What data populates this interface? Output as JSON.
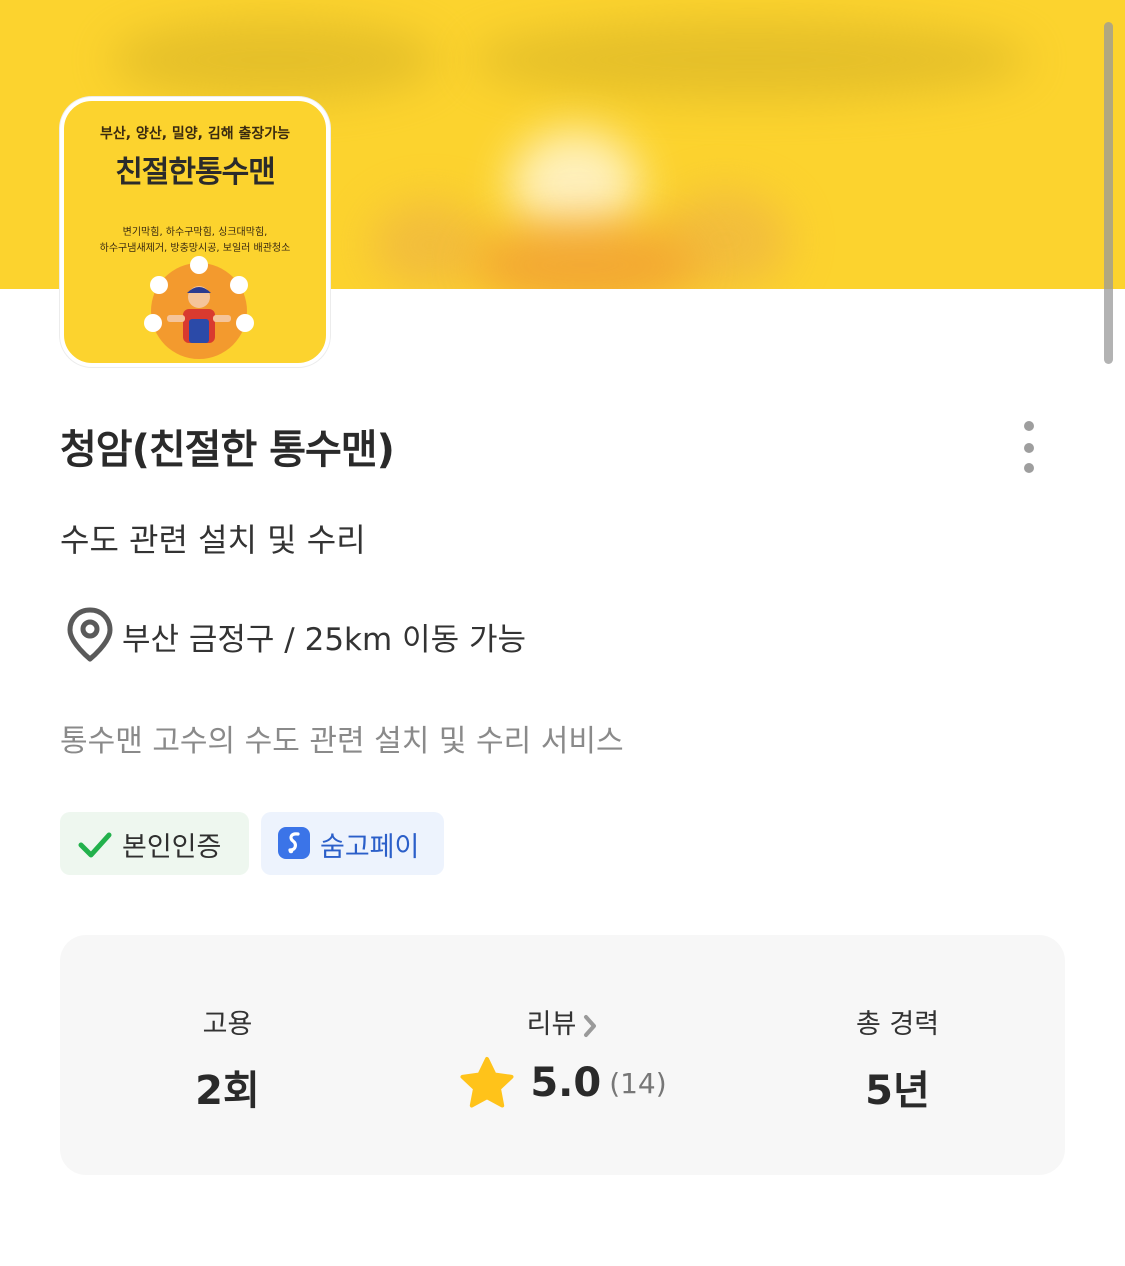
{
  "banner": {
    "background_color": "#fcd32e"
  },
  "profile_image": {
    "service_area": "부산, 양산, 밀양, 김해 출장가능",
    "brand": "친절한통수맨",
    "services_line1": "변기막힘, 하수구막힘, 싱크대막힘,",
    "services_line2": "하수구냄새제거, 방충망시공, 보일러 배관청소"
  },
  "profile": {
    "name": "청암(친절한 통수맨)",
    "category": "수도 관련 설치 및 수리",
    "location": "부산 금정구 / 25km 이동 가능",
    "intro": "통수맨 고수의 수도 관련 설치 및 수리 서비스",
    "more_icon": "more-vertical-icon",
    "location_icon": "map-pin-icon"
  },
  "badges": {
    "verified": {
      "label": "본인인증",
      "icon": "check-icon",
      "color": "#22b14c"
    },
    "pay": {
      "label": "숨고페이",
      "icon": "soomgo-pay-icon",
      "color": "#3b74e8"
    }
  },
  "stats": {
    "hire": {
      "label": "고용",
      "value": "2회"
    },
    "review": {
      "label": "리뷰",
      "rating": "5.0",
      "count": "(14)",
      "icon": "star-icon",
      "star_color": "#ffc31a"
    },
    "career": {
      "label": "총 경력",
      "value": "5년"
    }
  }
}
